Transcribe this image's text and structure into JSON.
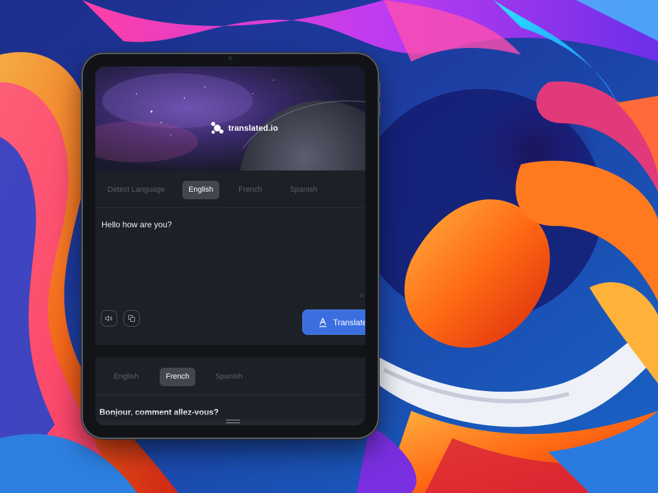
{
  "app": {
    "name": "translated.io"
  },
  "source_tabs": [
    {
      "label": "Detect Language",
      "active": false
    },
    {
      "label": "English",
      "active": true
    },
    {
      "label": "French",
      "active": false
    },
    {
      "label": "Spanish",
      "active": false
    }
  ],
  "source": {
    "text": "Hello how are you?",
    "char_count": "18"
  },
  "actions": {
    "speak_icon": "speaker-icon",
    "copy_icon": "copy-icon",
    "translate_label": "Translate",
    "translate_icon": "text-format-icon"
  },
  "target_tabs": [
    {
      "label": "English",
      "active": false
    },
    {
      "label": "French",
      "active": true
    },
    {
      "label": "Spanish",
      "active": false
    }
  ],
  "target": {
    "text": "Bonjour, comment allez-vous?"
  },
  "colors": {
    "accent": "#3b6fe0",
    "panel": "#1c2027",
    "active_tab": "#41464f"
  }
}
